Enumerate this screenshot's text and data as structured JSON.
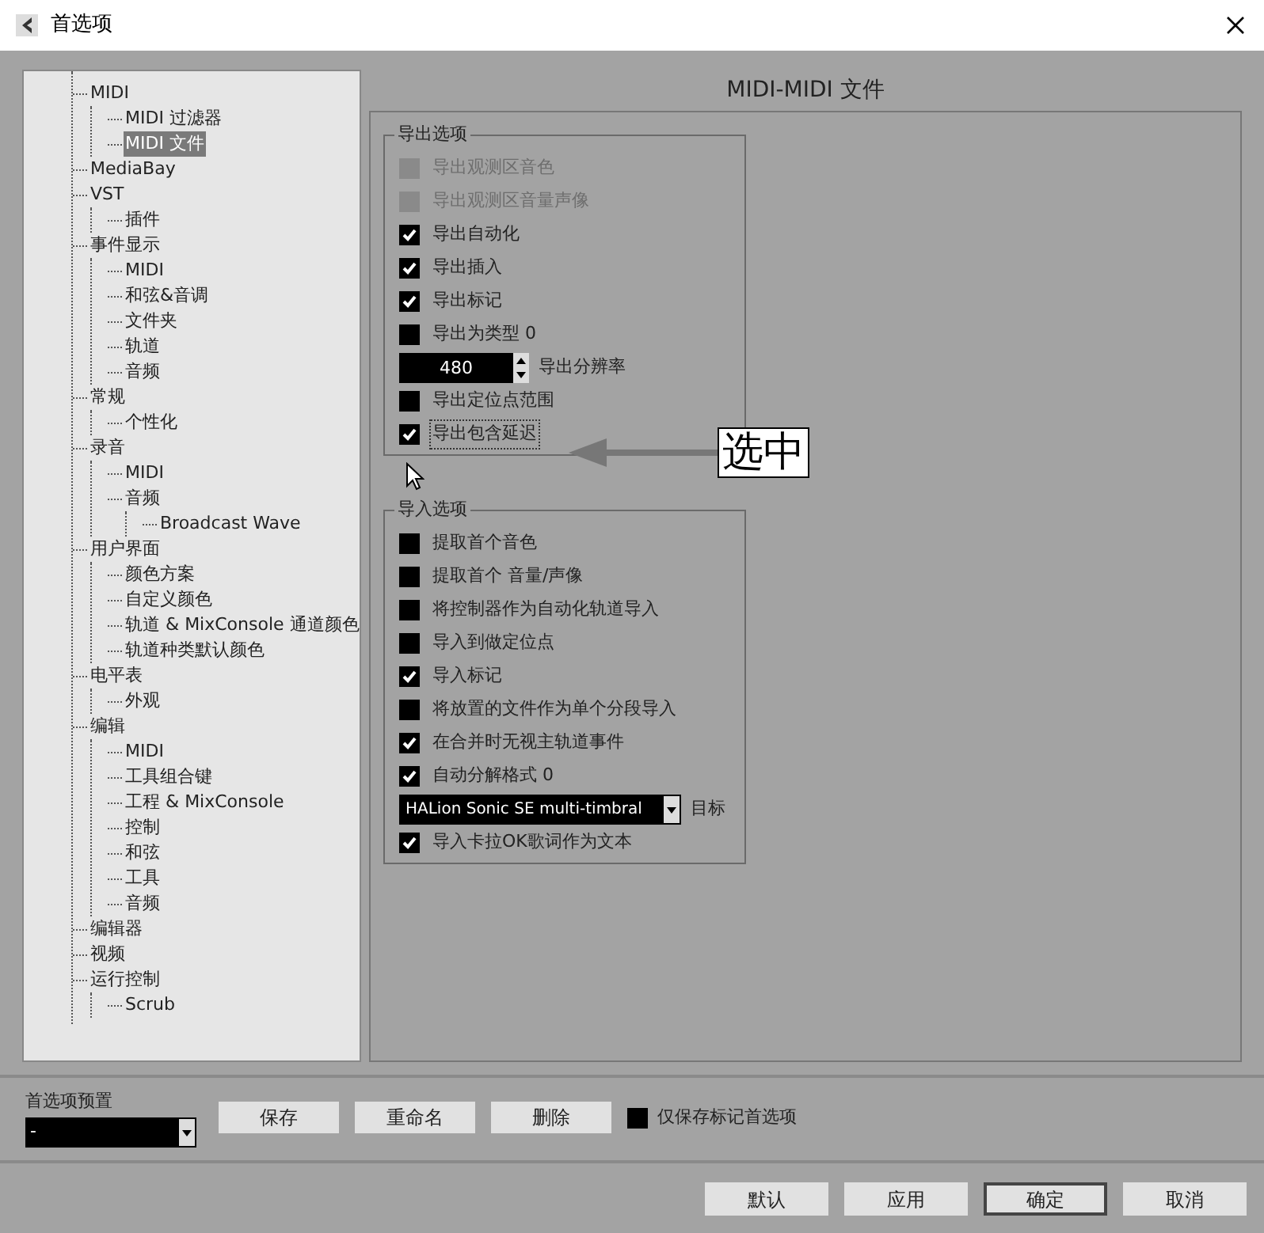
{
  "window": {
    "title": "首选项"
  },
  "tree": [
    {
      "label": "MIDI",
      "selected": false,
      "children": [
        {
          "label": "MIDI 过滤器",
          "selected": false
        },
        {
          "label": "MIDI 文件",
          "selected": true
        }
      ]
    },
    {
      "label": "MediaBay",
      "selected": false
    },
    {
      "label": "VST",
      "selected": false,
      "children": [
        {
          "label": "插件",
          "selected": false
        }
      ]
    },
    {
      "label": "事件显示",
      "selected": false,
      "children": [
        {
          "label": "MIDI",
          "selected": false
        },
        {
          "label": "和弦&音调",
          "selected": false
        },
        {
          "label": "文件夹",
          "selected": false
        },
        {
          "label": "轨道",
          "selected": false
        },
        {
          "label": "音频",
          "selected": false
        }
      ]
    },
    {
      "label": "常规",
      "selected": false,
      "children": [
        {
          "label": "个性化",
          "selected": false
        }
      ]
    },
    {
      "label": "录音",
      "selected": false,
      "children": [
        {
          "label": "MIDI",
          "selected": false
        },
        {
          "label": "音频",
          "selected": false,
          "children": [
            {
              "label": "Broadcast Wave",
              "selected": false
            }
          ]
        }
      ]
    },
    {
      "label": "用户界面",
      "selected": false,
      "children": [
        {
          "label": "颜色方案",
          "selected": false
        },
        {
          "label": "自定义颜色",
          "selected": false
        },
        {
          "label": "轨道 & MixConsole 通道颜色",
          "selected": false
        },
        {
          "label": "轨道种类默认颜色",
          "selected": false
        }
      ]
    },
    {
      "label": "电平表",
      "selected": false,
      "children": [
        {
          "label": "外观",
          "selected": false
        }
      ]
    },
    {
      "label": "编辑",
      "selected": false,
      "children": [
        {
          "label": "MIDI",
          "selected": false
        },
        {
          "label": "工具组合键",
          "selected": false
        },
        {
          "label": "工程 & MixConsole",
          "selected": false
        },
        {
          "label": "控制",
          "selected": false
        },
        {
          "label": "和弦",
          "selected": false
        },
        {
          "label": "工具",
          "selected": false
        },
        {
          "label": "音频",
          "selected": false
        }
      ]
    },
    {
      "label": "编辑器",
      "selected": false
    },
    {
      "label": "视频",
      "selected": false
    },
    {
      "label": "运行控制",
      "selected": false,
      "children": [
        {
          "label": "Scrub",
          "selected": false
        }
      ]
    }
  ],
  "page_title": "MIDI-MIDI 文件",
  "groups": [
    {
      "title": "导出选项",
      "rows": [
        {
          "kind": "checkbox",
          "label": "导出观测区音色",
          "checked": false,
          "disabled": true
        },
        {
          "kind": "checkbox",
          "label": "导出观测区音量声像",
          "checked": false,
          "disabled": true
        },
        {
          "kind": "checkbox",
          "label": "导出自动化",
          "checked": true,
          "disabled": false
        },
        {
          "kind": "checkbox",
          "label": "导出插入",
          "checked": true,
          "disabled": false
        },
        {
          "kind": "checkbox",
          "label": "导出标记",
          "checked": true,
          "disabled": false
        },
        {
          "kind": "checkbox",
          "label": "导出为类型 0",
          "checked": false,
          "disabled": false
        },
        {
          "kind": "spinbox",
          "value": "480",
          "caption": "导出分辨率"
        },
        {
          "kind": "checkbox",
          "label": "导出定位点范围",
          "checked": false,
          "disabled": false
        },
        {
          "kind": "checkbox",
          "label": "导出包含延迟",
          "checked": true,
          "disabled": false,
          "focused": true
        }
      ]
    },
    {
      "title": "导入选项",
      "rows": [
        {
          "kind": "checkbox",
          "label": "提取首个音色",
          "checked": false,
          "disabled": false
        },
        {
          "kind": "checkbox",
          "label": "提取首个 音量/声像",
          "checked": false,
          "disabled": false
        },
        {
          "kind": "checkbox",
          "label": "将控制器作为自动化轨道导入",
          "checked": false,
          "disabled": false
        },
        {
          "kind": "checkbox",
          "label": "导入到做定位点",
          "checked": false,
          "disabled": false
        },
        {
          "kind": "checkbox",
          "label": "导入标记",
          "checked": true,
          "disabled": false
        },
        {
          "kind": "checkbox",
          "label": "将放置的文件作为单个分段导入",
          "checked": false,
          "disabled": false
        },
        {
          "kind": "checkbox",
          "label": "在合并时无视主轨道事件",
          "checked": true,
          "disabled": false
        },
        {
          "kind": "checkbox",
          "label": "自动分解格式 0",
          "checked": true,
          "disabled": false
        },
        {
          "kind": "dropdown",
          "value": "HALion Sonic SE multi-timbral",
          "caption": "目标"
        },
        {
          "kind": "checkbox",
          "label": "导入卡拉OK歌词作为文本",
          "checked": true,
          "disabled": false
        }
      ]
    }
  ],
  "annotation": {
    "text": "选中"
  },
  "presets": {
    "label": "首选项预置",
    "value": "-",
    "buttons": [
      "保存",
      "重命名",
      "删除"
    ],
    "checkbox": {
      "label": "仅保存标记首选项",
      "checked": false
    }
  },
  "footer_buttons": [
    {
      "label": "默认",
      "default": false
    },
    {
      "label": "应用",
      "default": false
    },
    {
      "label": "确定",
      "default": true
    },
    {
      "label": "取消",
      "default": false
    }
  ]
}
